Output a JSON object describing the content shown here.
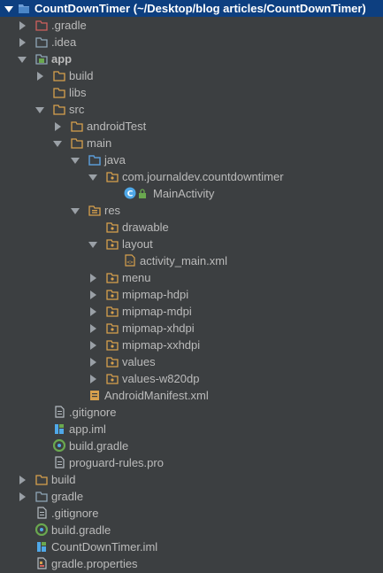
{
  "tree": {
    "rows": [
      {
        "label": "CountDownTimer",
        "suffix": " (~/Desktop/blog articles/CountDownTimer)",
        "icon": "project-folder-icon"
      },
      {
        "label": ".gradle",
        "icon": "folder-red-icon"
      },
      {
        "label": ".idea",
        "icon": "folder-icon"
      },
      {
        "label": "app",
        "icon": "module-folder-icon"
      },
      {
        "label": "build",
        "icon": "folder-icon"
      },
      {
        "label": "libs",
        "icon": "folder-icon"
      },
      {
        "label": "src",
        "icon": "folder-icon"
      },
      {
        "label": "androidTest",
        "icon": "folder-icon"
      },
      {
        "label": "main",
        "icon": "folder-icon"
      },
      {
        "label": "java",
        "icon": "source-folder-icon"
      },
      {
        "label": "com.journaldev.countdowntimer",
        "icon": "package-icon"
      },
      {
        "label": "MainActivity",
        "icon": "class-icon"
      },
      {
        "label": "res",
        "icon": "resource-folder-icon"
      },
      {
        "label": "drawable",
        "icon": "package-icon"
      },
      {
        "label": "layout",
        "icon": "package-icon"
      },
      {
        "label": "activity_main.xml",
        "icon": "xml-file-icon"
      },
      {
        "label": "menu",
        "icon": "package-icon"
      },
      {
        "label": "mipmap-hdpi",
        "icon": "package-icon"
      },
      {
        "label": "mipmap-mdpi",
        "icon": "package-icon"
      },
      {
        "label": "mipmap-xhdpi",
        "icon": "package-icon"
      },
      {
        "label": "mipmap-xxhdpi",
        "icon": "package-icon"
      },
      {
        "label": "values",
        "icon": "package-icon"
      },
      {
        "label": "values-w820dp",
        "icon": "package-icon"
      },
      {
        "label": "AndroidManifest.xml",
        "icon": "manifest-file-icon"
      },
      {
        "label": ".gitignore",
        "icon": "text-file-icon"
      },
      {
        "label": "app.iml",
        "icon": "iml-file-icon"
      },
      {
        "label": "build.gradle",
        "icon": "gradle-file-icon"
      },
      {
        "label": "proguard-rules.pro",
        "icon": "text-file-icon"
      },
      {
        "label": "build",
        "icon": "folder-icon"
      },
      {
        "label": "gradle",
        "icon": "folder-icon"
      },
      {
        "label": ".gitignore",
        "icon": "text-file-icon"
      },
      {
        "label": "build.gradle",
        "icon": "gradle-file-icon"
      },
      {
        "label": "CountDownTimer.iml",
        "icon": "iml-file-icon"
      },
      {
        "label": "gradle.properties",
        "icon": "properties-file-icon"
      }
    ]
  },
  "colors": {
    "background": "#3c3f41",
    "selection": "#0d3f80",
    "text": "#bbbbbb",
    "folder": "#90a6b8",
    "java_folder": "#5b9bd5",
    "orange": "#d7a04d"
  }
}
